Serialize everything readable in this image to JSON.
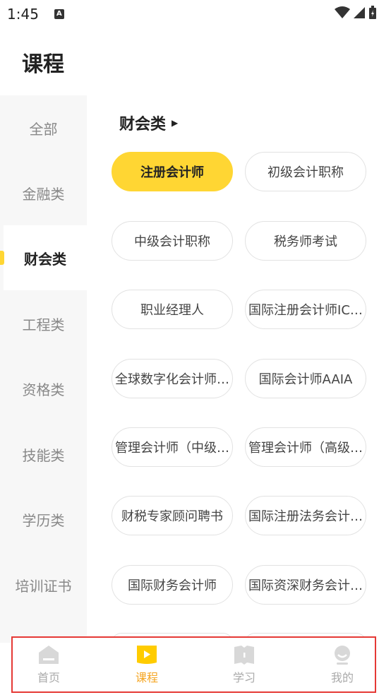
{
  "status_bar": {
    "time": "1:45",
    "notification_icon": "A"
  },
  "page": {
    "title": "课程"
  },
  "sidebar": {
    "items": [
      {
        "label": "全部"
      },
      {
        "label": "金融类"
      },
      {
        "label": "财会类",
        "active": true
      },
      {
        "label": "工程类"
      },
      {
        "label": "资格类"
      },
      {
        "label": "技能类"
      },
      {
        "label": "学历类"
      },
      {
        "label": "培训证书"
      }
    ]
  },
  "section": {
    "title": "财会类"
  },
  "courses": [
    {
      "label": "注册会计师",
      "active": true
    },
    {
      "label": "初级会计职称"
    },
    {
      "label": "中级会计职称"
    },
    {
      "label": "税务师考试"
    },
    {
      "label": "职业经理人"
    },
    {
      "label": "国际注册会计师IC…"
    },
    {
      "label": "全球数字化会计师…"
    },
    {
      "label": "国际会计师AAIA"
    },
    {
      "label": "管理会计师（中级…"
    },
    {
      "label": "管理会计师（高级…"
    },
    {
      "label": "财税专家顾问聘书"
    },
    {
      "label": "国际注册法务会计…"
    },
    {
      "label": "国际财务会计师"
    },
    {
      "label": "国际资深财务会计…"
    }
  ],
  "tabbar": {
    "tabs": [
      {
        "label": "首页",
        "icon": "home-icon"
      },
      {
        "label": "课程",
        "icon": "course-icon",
        "active": true
      },
      {
        "label": "学习",
        "icon": "book-icon"
      },
      {
        "label": "我的",
        "icon": "profile-icon"
      }
    ]
  },
  "colors": {
    "accent": "#ffd633",
    "active_tab": "#f5a623",
    "highlight_border": "#e53935"
  }
}
